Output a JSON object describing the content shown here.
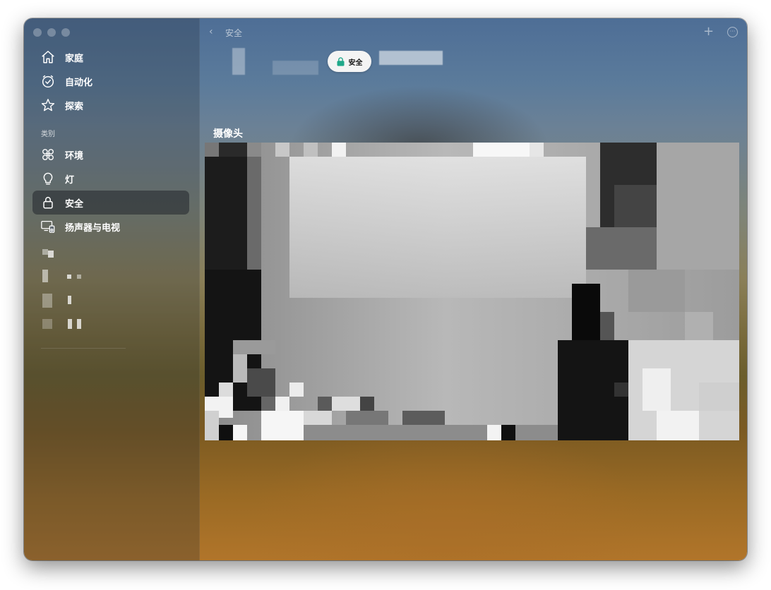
{
  "window": {
    "title": "安全"
  },
  "sidebar": {
    "nav": [
      {
        "label": "家庭",
        "icon": "house-icon"
      },
      {
        "label": "自动化",
        "icon": "clock-icon"
      },
      {
        "label": "探索",
        "icon": "star-icon"
      }
    ],
    "section_label": "类别",
    "categories": [
      {
        "label": "环境",
        "icon": "fan-icon"
      },
      {
        "label": "灯",
        "icon": "bulb-icon"
      },
      {
        "label": "安全",
        "icon": "lock-icon",
        "selected": true
      },
      {
        "label": "扬声器与电视",
        "icon": "tv-speaker-icon"
      }
    ]
  },
  "toolbar": {
    "back_icon": "chevron-left-icon",
    "title": "安全",
    "add_icon": "plus-icon",
    "more_icon": "ellipsis-icon",
    "more_glyph": "···"
  },
  "filter": {
    "pill_label": "安全",
    "pill_icon": "lock-icon",
    "pill_icon_color": "#1fa88a"
  },
  "camera": {
    "section_title": "摄像头"
  },
  "colors": {
    "accent": "#1fa88a",
    "selected_row": "#2d3237"
  }
}
